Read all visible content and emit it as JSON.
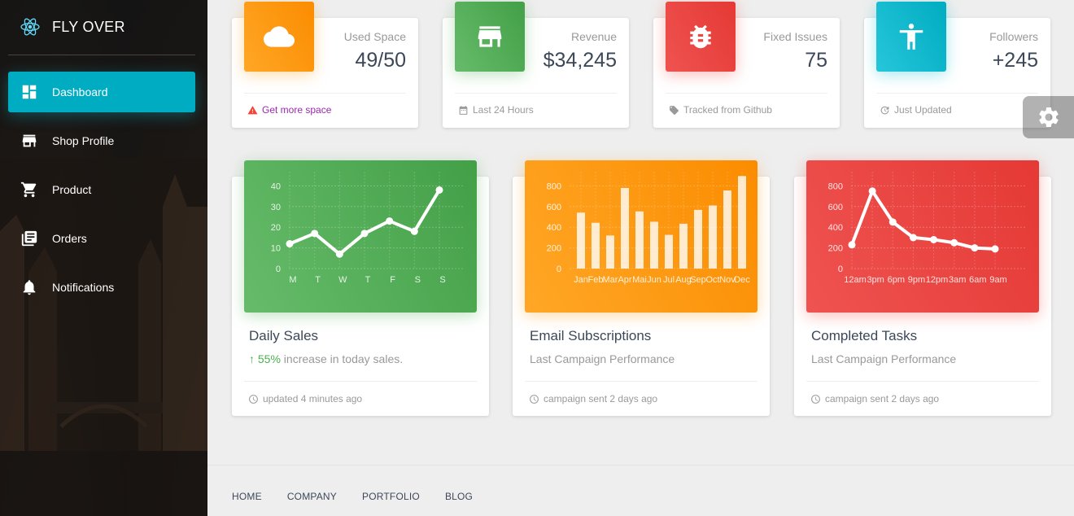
{
  "brand": {
    "name": "FLY OVER"
  },
  "sidebar": {
    "items": [
      {
        "label": "Dashboard",
        "icon": "dashboard-icon",
        "active": true
      },
      {
        "label": "Shop Profile",
        "icon": "store-icon"
      },
      {
        "label": "Product",
        "icon": "cart-icon"
      },
      {
        "label": "Orders",
        "icon": "library-icon"
      },
      {
        "label": "Notifications",
        "icon": "bell-icon"
      }
    ]
  },
  "stats": [
    {
      "category": "Used Space",
      "value": "49/50",
      "footer": "Get more space",
      "icon": "cloud-icon",
      "footer_icon": "warning-icon",
      "color": "#fb8c00"
    },
    {
      "category": "Revenue",
      "value": "$34,245",
      "footer": "Last 24 Hours",
      "icon": "store-icon",
      "footer_icon": "calendar-icon",
      "color": "#43a047"
    },
    {
      "category": "Fixed Issues",
      "value": "75",
      "footer": "Tracked from Github",
      "icon": "bug-icon",
      "footer_icon": "tag-icon",
      "color": "#e53935"
    },
    {
      "category": "Followers",
      "value": "+245",
      "footer": "Just Updated",
      "icon": "accessibility-icon",
      "footer_icon": "update-icon",
      "color": "#00acc1"
    }
  ],
  "cards": [
    {
      "title": "Daily Sales",
      "subtitle_pct": "55%",
      "subtitle_rest": " increase in today sales.",
      "footer": "updated 4 minutes ago"
    },
    {
      "title": "Email Subscriptions",
      "subtitle": "Last Campaign Performance",
      "footer": "campaign sent 2 days ago"
    },
    {
      "title": "Completed Tasks",
      "subtitle": "Last Campaign Performance",
      "footer": "campaign sent 2 days ago"
    }
  ],
  "chart_data": [
    {
      "type": "line",
      "categories": [
        "M",
        "T",
        "W",
        "T",
        "F",
        "S",
        "S"
      ],
      "values": [
        12,
        17,
        7,
        17,
        23,
        18,
        38
      ],
      "yticks": [
        0,
        10,
        20,
        30,
        40
      ],
      "ylim": [
        0,
        50
      ],
      "color": "#43a047"
    },
    {
      "type": "bar",
      "categories": [
        "Jan",
        "Feb",
        "Mar",
        "Apr",
        "Mai",
        "Jun",
        "Jul",
        "Aug",
        "Sep",
        "Oct",
        "Nov",
        "Dec"
      ],
      "values": [
        542,
        443,
        320,
        780,
        553,
        453,
        326,
        434,
        568,
        610,
        756,
        895
      ],
      "yticks": [
        0,
        200,
        400,
        600,
        800
      ],
      "ylim": [
        0,
        1000
      ],
      "color": "#fb8c00"
    },
    {
      "type": "line",
      "categories": [
        "12am",
        "3pm",
        "6pm",
        "9pm",
        "12pm",
        "3am",
        "6am",
        "9am"
      ],
      "values": [
        230,
        750,
        450,
        300,
        280,
        250,
        200,
        190
      ],
      "yticks": [
        0,
        200,
        400,
        600,
        800
      ],
      "ylim": [
        0,
        1000
      ],
      "color": "#e53935"
    }
  ],
  "footer": {
    "links": [
      "HOME",
      "COMPANY",
      "PORTFOLIO",
      "BLOG"
    ]
  }
}
